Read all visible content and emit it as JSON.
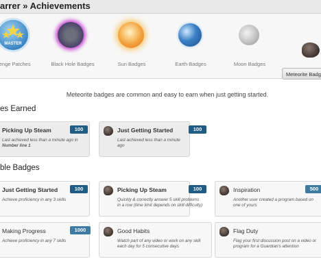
{
  "breadcrumb": "arrer » Achievements",
  "categories": [
    {
      "label": "llenge Patches",
      "icon": "challenge-patch-icon"
    },
    {
      "label": "Black Hole Badges",
      "icon": "black-hole-icon"
    },
    {
      "label": "Sun Badges",
      "icon": "sun-icon"
    },
    {
      "label": "Earth Badges",
      "icon": "earth-icon"
    },
    {
      "label": "Moon Badges",
      "icon": "moon-icon"
    },
    {
      "label": "Meteorite Badg",
      "icon": "meteorite-icon"
    }
  ],
  "master_text": "MASTER",
  "intro": "Meteorite badges are common and easy to earn when just getting started.",
  "earned_title": "es Earned",
  "available_title": "ble Badges",
  "earned": [
    {
      "name": "Picking Up Steam",
      "points": "100",
      "desc": "Last achieved less than a minute ago in",
      "desc_bold": "Number line 1"
    },
    {
      "name": "Just Getting Started",
      "points": "100",
      "desc": "Last achieved less than a minute ago",
      "desc_bold": ""
    }
  ],
  "available": [
    {
      "name": "Just Getting Started",
      "points": "100",
      "desc": "Achieve proficiency in any 3 skills"
    },
    {
      "name": "Picking Up Steam",
      "points": "100",
      "desc": "Quickly & correctly answer 5 skill problems in a row (time limit depends on skill difficulty)"
    },
    {
      "name": "Inspiration",
      "points": "500",
      "desc": "Another user created a program based on one of yours"
    },
    {
      "name": "Making Progress",
      "points": "1000",
      "desc": "Achieve proficiency in any 7 skills"
    },
    {
      "name": "Good Habits",
      "points": "",
      "desc": "Watch part of any video or work on any skill each day for 5 consecutive days"
    },
    {
      "name": "Flag Duty",
      "points": "",
      "desc": "Flag your first discussion post on a video or program for a Guardian's attention"
    }
  ],
  "colors": {
    "points_bg": "#1f5c86",
    "points_bg_light": "#3e7ba3"
  }
}
